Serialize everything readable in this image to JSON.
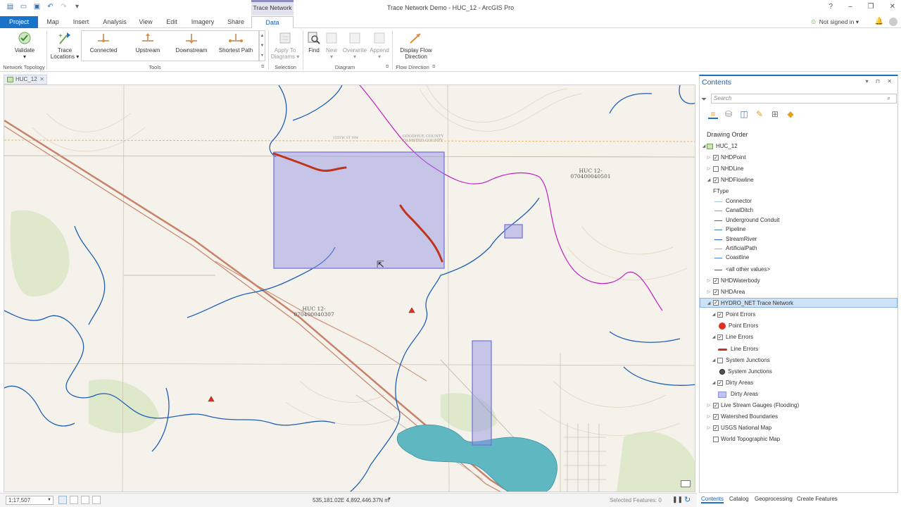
{
  "window": {
    "title": "Trace Network Demo - HUC_12 - ArcGIS Pro",
    "contextual_tab_header": "Trace Network",
    "signin": "Not signed in",
    "controls": [
      "?",
      "–",
      "❐",
      "✕"
    ]
  },
  "tabs": [
    {
      "label": "Project",
      "active": false
    },
    {
      "label": "Map"
    },
    {
      "label": "Insert"
    },
    {
      "label": "Analysis"
    },
    {
      "label": "View"
    },
    {
      "label": "Edit"
    },
    {
      "label": "Imagery"
    },
    {
      "label": "Share"
    },
    {
      "label": "Data",
      "active": true
    }
  ],
  "ribbon": {
    "validate": "Validate",
    "trace_locations": "Trace Locations",
    "connected": "Connected",
    "upstream": "Upstream",
    "downstream": "Downstream",
    "shortest_path": "Shortest Path",
    "apply_to_diagrams": "Apply To Diagrams",
    "find": "Find",
    "new": "New",
    "overwrite": "Overwrite",
    "append": "Append",
    "display_flow_direction": "Display Flow Direction",
    "groups": {
      "network_topology": "Network Topology",
      "tools": "Tools",
      "selection": "Selection",
      "diagram": "Diagram",
      "flow_direction": "Flow Direction"
    }
  },
  "map_view": {
    "tab_label": "HUC_12",
    "labels": {
      "huc_north": "HUC 12-\n070400040501",
      "huc_south": "HUC 12-\n070400040307",
      "county": "GOODHUE COUNTY\nOLMSTED COUNTY",
      "road1": "155TH ST NW"
    }
  },
  "status": {
    "scale": "1:17,507",
    "coordinates": "535,181.02E 4,892,446.37N m",
    "selected_features": "Selected Features: 0"
  },
  "contents": {
    "title": "Contents",
    "search_placeholder": "Search",
    "drawing_order": "Drawing Order",
    "map_name": "HUC_12",
    "layers": {
      "nhd_point": "NHDPoint",
      "nhd_line": "NHDLine",
      "nhd_flowline": "NHDFlowline",
      "ftype": "FType",
      "ftype_values": [
        {
          "label": "Connector",
          "color": "#9fc5e8"
        },
        {
          "label": "CanalDitch",
          "color": "#6fa8dc"
        },
        {
          "label": "Underground Conduit",
          "color": "#c21fc2"
        },
        {
          "label": "Pipeline",
          "color": "#3d85c6"
        },
        {
          "label": "StreamRiver",
          "color": "#1f5fb4"
        },
        {
          "label": "ArtificialPath",
          "color": "#93c47d"
        },
        {
          "label": "Coastline",
          "color": "#4a86e8"
        },
        {
          "label": "<all other values>",
          "color": "#555555"
        }
      ],
      "nhd_waterbody": "NHDWaterbody",
      "nhd_area": "NHDArea",
      "trace_network": "HYDRO_NET Trace Network",
      "point_errors": "Point Errors",
      "line_errors": "Line Errors",
      "system_junctions": "System Junctions",
      "dirty_areas": "Dirty Areas",
      "gauges": "Live Stream Gauges (Flooding)",
      "watershed": "Watershed Boundaries",
      "usgs": "USGS National Map",
      "topo": "World Topographic Map"
    },
    "bottom_tabs": [
      "Contents",
      "Catalog",
      "Geoprocessing",
      "Create Features"
    ]
  },
  "colors": {
    "accent": "#1a73c8",
    "dirty_area_fill": "#c3c3f0",
    "line_error": "#c0341d",
    "point_error": "#e0301e"
  }
}
